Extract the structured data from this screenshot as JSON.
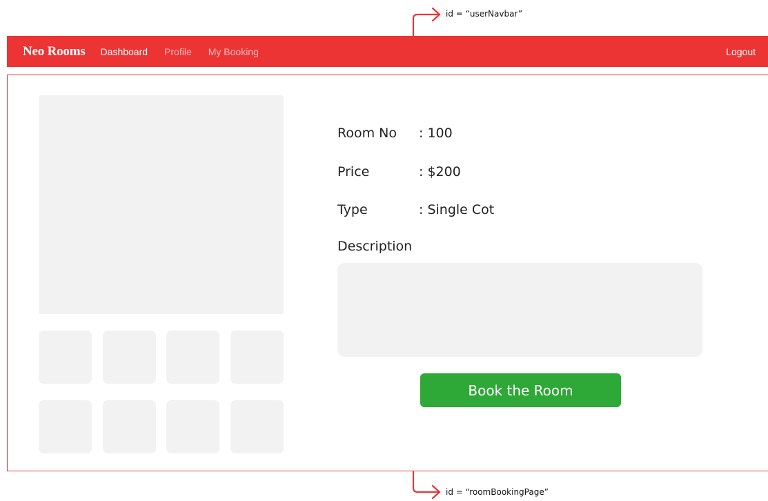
{
  "annotations": {
    "navbar_id_label": "id = “userNavbar”",
    "page_id_label": "id = “roomBookingPage”",
    "arrow_color": "#ec3434"
  },
  "navbar": {
    "brand": "Neo Rooms",
    "links": [
      {
        "label": "Dashboard",
        "active": true
      },
      {
        "label": "Profile",
        "active": false
      },
      {
        "label": "My Booking",
        "active": false
      }
    ],
    "logout_label": "Logout",
    "background_color": "#ec3434"
  },
  "room": {
    "details": [
      {
        "label": "Room No",
        "value": ": 100"
      },
      {
        "label": "Price",
        "value": ": $200"
      },
      {
        "label": "Type",
        "value": ": Single Cot"
      }
    ],
    "description_label": "Description",
    "description_text": "",
    "book_button_label": "Book the Room",
    "book_button_color": "#2ea836"
  },
  "gallery": {
    "main_image": "room-image-placeholder",
    "thumbnail_count": 8
  }
}
